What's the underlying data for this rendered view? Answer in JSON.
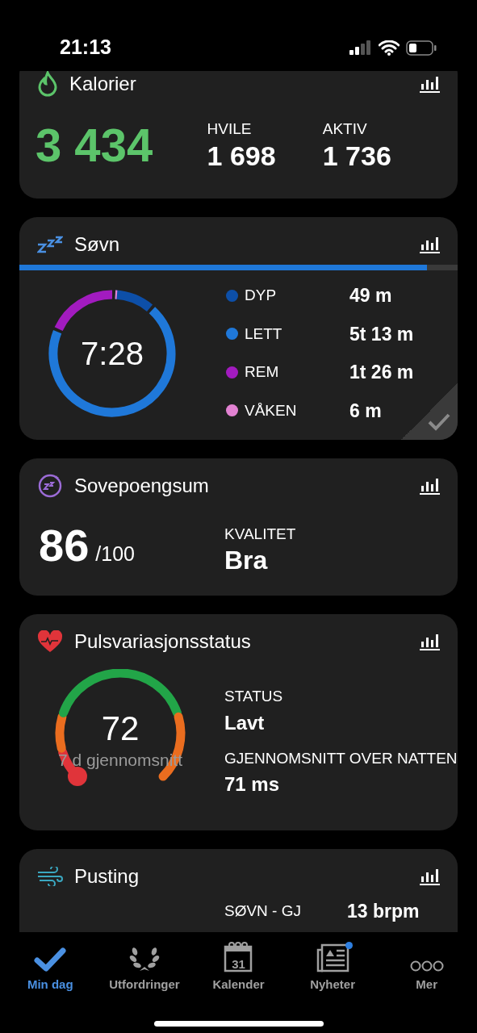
{
  "status_bar": {
    "time": "21:13"
  },
  "cards": [
    {
      "kind": "calories",
      "title": "Kalorier",
      "total": "3 434",
      "stats": [
        {
          "label": "HVILE",
          "value": "1 698"
        },
        {
          "label": "AKTIV",
          "value": "1 736"
        }
      ]
    },
    {
      "kind": "sleep",
      "title": "Søvn",
      "level": 0.93,
      "total": "7:28",
      "confirmed": true,
      "stages": [
        {
          "label": "DYP",
          "value": "49 m",
          "color": "#0d4fa8"
        },
        {
          "label": "LETT",
          "value": "5t 13 m",
          "color": "#1f78d9"
        },
        {
          "label": "REM",
          "value": "1t 26 m",
          "color": "#a21bbf"
        },
        {
          "label": "VÅKEN",
          "value": "6 m",
          "color": "#e282d2"
        }
      ]
    },
    {
      "kind": "score",
      "title": "Sovepoengsum",
      "score": "86",
      "max": "/100",
      "stats": [
        {
          "label": "KVALITET",
          "value": "Bra"
        }
      ]
    },
    {
      "kind": "hrv",
      "title": "Pulsvariasjonsstatus",
      "value": "72",
      "caption": "7 d gjennomsnitt",
      "stats": [
        {
          "label": "STATUS",
          "value": "Lavt"
        },
        {
          "label": "GJENNOMSNITT OVER NATTEN",
          "value": "71 ms"
        }
      ]
    },
    {
      "kind": "breathing",
      "title": "Pusting",
      "stats": [
        {
          "label": "SØVN - GJ",
          "value": "13 brpm"
        }
      ]
    }
  ],
  "tab_bar": [
    {
      "kind": "check",
      "label": "Min dag",
      "selected": true
    },
    {
      "kind": "laurel",
      "label": "Utfordringer",
      "selected": false
    },
    {
      "kind": "calendar",
      "label": "Kalender",
      "icon_text": "31",
      "selected": false
    },
    {
      "kind": "news",
      "label": "Nyheter",
      "badge": true,
      "selected": false
    },
    {
      "kind": "more",
      "label": "Mer",
      "selected": false
    }
  ]
}
